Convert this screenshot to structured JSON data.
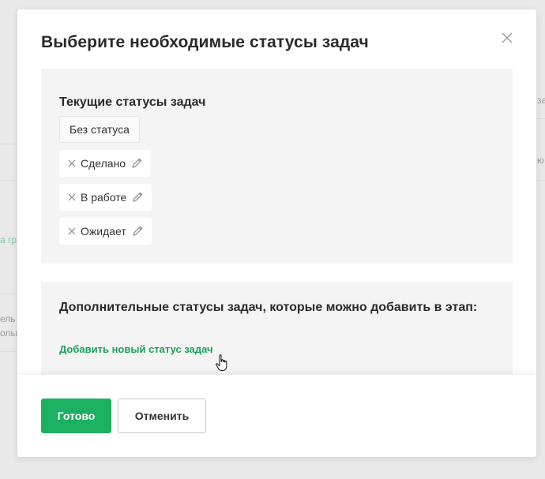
{
  "background": {
    "right_text_top": "за",
    "right_text_mid": "ю",
    "left_link": "а гр",
    "left_text_1": "ель",
    "left_text_2": "олы"
  },
  "modal": {
    "title": "Выберите необходимые статусы задач",
    "close_icon": "close-icon",
    "current": {
      "heading": "Текущие статусы задач",
      "default_status": "Без статуса",
      "statuses": [
        {
          "label": "Сделано"
        },
        {
          "label": "В работе"
        },
        {
          "label": "Ожидает"
        }
      ]
    },
    "extra": {
      "heading": "Дополнительные статусы задач, которые можно добавить в этап:",
      "add_link": "Добавить новый статус задач"
    },
    "footer": {
      "done_label": "Готово",
      "cancel_label": "Отменить"
    }
  },
  "colors": {
    "accent": "#1cb062",
    "link": "#1aa157",
    "panel_bg": "#f4f4f4"
  }
}
